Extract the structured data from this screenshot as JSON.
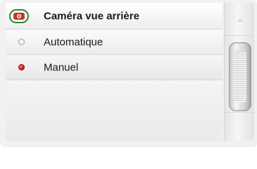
{
  "header": {
    "title": "Caméra vue arrière",
    "icon": "rear-camera-icon"
  },
  "options": [
    {
      "label": "Automatique",
      "selected": false
    },
    {
      "label": "Manuel",
      "selected": true
    }
  ],
  "colors": {
    "selected_radio": "#cc1e1e",
    "icon_ring": "#2e8b2e"
  }
}
